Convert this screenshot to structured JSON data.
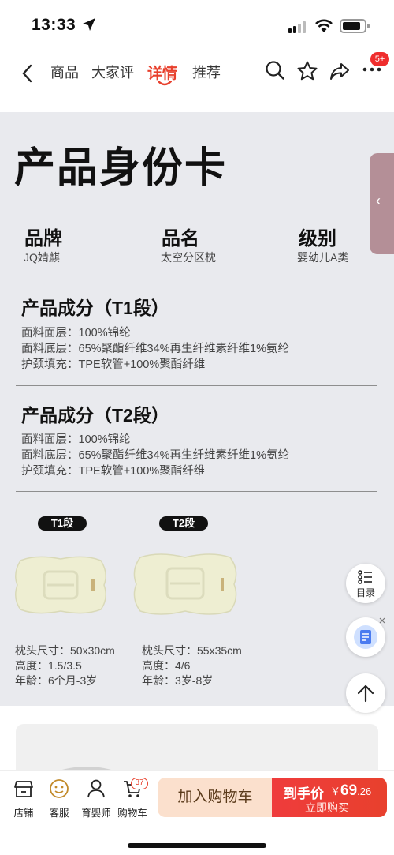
{
  "status": {
    "time": "13:33"
  },
  "nav": {
    "tabs": [
      {
        "label": "商品"
      },
      {
        "label": "大家评"
      },
      {
        "label": "详情"
      },
      {
        "label": "推荐"
      }
    ],
    "more_badge": "5+"
  },
  "detail": {
    "title": "产品身份卡",
    "fields": [
      {
        "head": "品牌",
        "value": "JQ婧麒"
      },
      {
        "head": "品名",
        "value": "太空分区枕"
      },
      {
        "head": "级别",
        "value": "婴幼儿A类"
      }
    ],
    "sections": [
      {
        "title": "产品成分（T1段）",
        "lines": [
          "面料面层：100%锦纶",
          "面料底层：65%聚酯纤维34%再生纤维素纤维1%氨纶",
          "护颈填充：TPE软管+100%聚酯纤维"
        ]
      },
      {
        "title": "产品成分（T2段）",
        "lines": [
          "面料面层：100%锦纶",
          "面料底层：65%聚酯纤维34%再生纤维素纤维1%氨纶",
          "护颈填充：TPE软管+100%聚酯纤维"
        ]
      }
    ],
    "products": [
      {
        "segment": "T1段",
        "size": "枕头尺寸：50x30cm",
        "height": "高度：1.5/3.5",
        "age": "年龄：6个月-3岁"
      },
      {
        "segment": "T2段",
        "size": "枕头尺寸：55x35cm",
        "height": "高度：4/6",
        "age": "年龄：3岁-8岁"
      }
    ]
  },
  "floating": {
    "toc_label": "目录"
  },
  "bottom_bar": {
    "items": [
      {
        "label": "店铺"
      },
      {
        "label": "客服"
      },
      {
        "label": "育婴师"
      },
      {
        "label": "购物车"
      }
    ],
    "cart_count": "37",
    "add_to_cart": "加入购物车",
    "price_label": "到手价",
    "price_currency": "￥",
    "price_int": "69",
    "price_dec": ".26",
    "buy_now": "立即购买"
  },
  "colors": {
    "accent": "#e8402d",
    "card_bg": "#e9eaee"
  }
}
